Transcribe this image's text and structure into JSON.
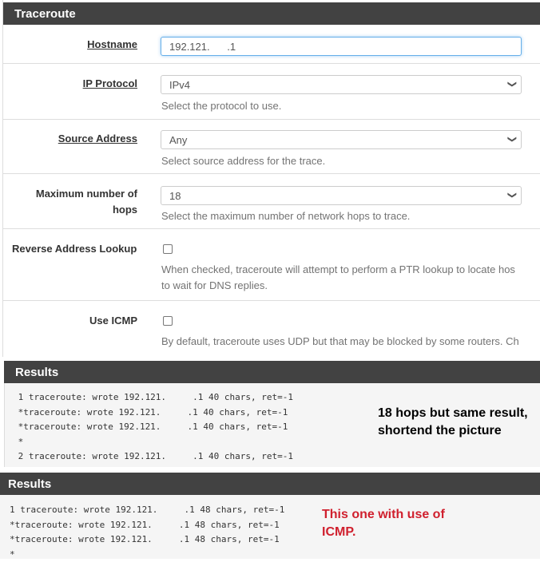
{
  "traceroute": {
    "title": "Traceroute",
    "hostname": {
      "label": "Hostname",
      "value": "192.121.      .1"
    },
    "ip_protocol": {
      "label": "IP Protocol",
      "value": "IPv4",
      "help": "Select the protocol to use."
    },
    "source_address": {
      "label": "Source Address",
      "value": "Any",
      "help": "Select source address for the trace."
    },
    "max_hops": {
      "label_line1": "Maximum number of",
      "label_line2": "hops",
      "value": "18",
      "help": "Select the maximum number of network hops to trace."
    },
    "reverse_lookup": {
      "label": "Reverse Address Lookup",
      "checked": false,
      "help_line1": "When checked, traceroute will attempt to perform a PTR lookup to locate hos",
      "help_line2": "to wait for DNS replies."
    },
    "use_icmp": {
      "label": "Use ICMP",
      "checked": false,
      "help": "By default, traceroute uses UDP but that may be blocked by some routers. Ch"
    }
  },
  "results1": {
    "title": "Results",
    "lines": [
      " 1 traceroute: wrote 192.121.     .1 40 chars, ret=-1",
      " *traceroute: wrote 192.121.     .1 40 chars, ret=-1",
      " *traceroute: wrote 192.121.     .1 40 chars, ret=-1",
      " *",
      " 2 traceroute: wrote 192.121.     .1 40 chars, ret=-1"
    ],
    "note_line1": "18 hops but same result,",
    "note_line2": "shortend the picture"
  },
  "results2": {
    "title": "Results",
    "lines": [
      "1 traceroute: wrote 192.121.     .1 48 chars, ret=-1",
      "*traceroute: wrote 192.121.     .1 48 chars, ret=-1",
      "*traceroute: wrote 192.121.     .1 48 chars, ret=-1",
      "*"
    ],
    "note_line1": "This one with use of",
    "note_line2": "ICMP.",
    "note_color": "#d0202e"
  }
}
